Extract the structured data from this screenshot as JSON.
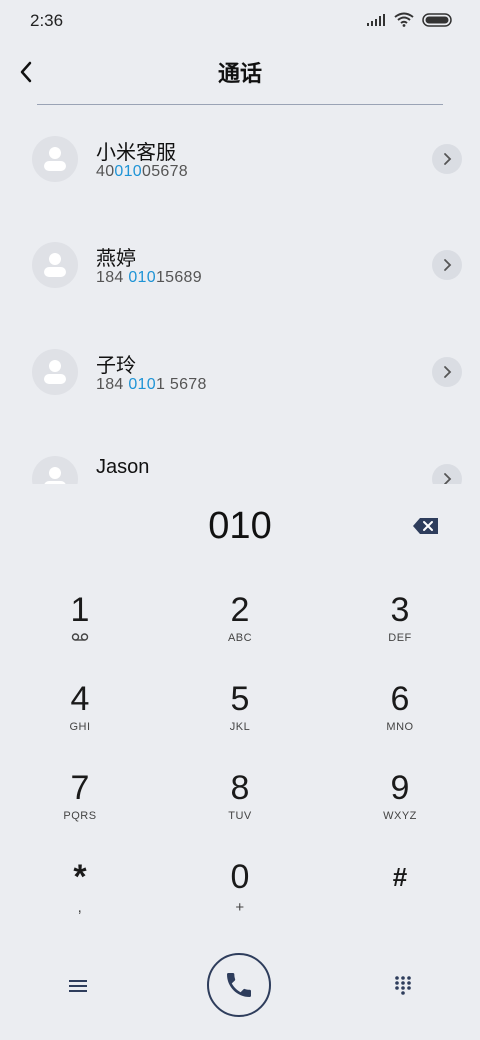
{
  "status_bar": {
    "time": "2:36"
  },
  "header": {
    "title": "通话"
  },
  "contacts": [
    {
      "name": "小米客服",
      "number_pre": "40",
      "number_match": "010",
      "number_post": "05678"
    },
    {
      "name": "燕婷",
      "number_pre": "184 ",
      "number_match": "010",
      "number_post": "15689"
    },
    {
      "name": "子玲",
      "number_pre": "184 ",
      "number_match": "010",
      "number_post": "1 5678"
    },
    {
      "name": "Jason",
      "number_pre": "",
      "number_match": "",
      "number_post": ""
    }
  ],
  "dial": {
    "input": "010"
  },
  "keypad": [
    {
      "digit": "1",
      "letters": ""
    },
    {
      "digit": "2",
      "letters": "ABC"
    },
    {
      "digit": "3",
      "letters": "DEF"
    },
    {
      "digit": "4",
      "letters": "GHI"
    },
    {
      "digit": "5",
      "letters": "JKL"
    },
    {
      "digit": "6",
      "letters": "MNO"
    },
    {
      "digit": "7",
      "letters": "PQRS"
    },
    {
      "digit": "8",
      "letters": "TUV"
    },
    {
      "digit": "9",
      "letters": "WXYZ"
    },
    {
      "digit": "*",
      "letters": ","
    },
    {
      "digit": "0",
      "letters": "+"
    },
    {
      "digit": "#",
      "letters": ""
    }
  ],
  "icons": {
    "back": "chevron-left-icon",
    "voicemail": "voicemail-icon",
    "backspace": "backspace-icon",
    "menu": "menu-icon",
    "call": "phone-icon",
    "dialpad": "dialpad-icon"
  },
  "colors": {
    "accent": "#1e94d6",
    "background": "#EBEDF1",
    "icon": "#2e3d5c"
  }
}
